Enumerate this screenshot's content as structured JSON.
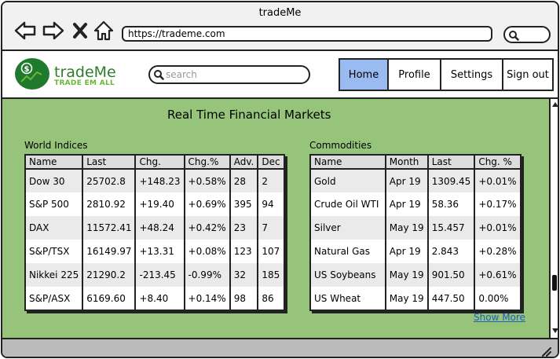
{
  "window": {
    "title": "tradeMe"
  },
  "browser": {
    "url": "https://trademe.com"
  },
  "brand": {
    "name": "tradeMe",
    "tagline": "TRADE EM ALL",
    "color": "#1f7a2e"
  },
  "search": {
    "placeholder": "search"
  },
  "nav": {
    "home": "Home",
    "profile": "Profile",
    "settings": "Settings",
    "signout": "Sign out",
    "active": "Home",
    "active_color": "#99bbf2"
  },
  "page": {
    "title": "Real Time Financial Markets",
    "background": "#95c47a",
    "show_more": "Show More"
  },
  "world_indices": {
    "label": "World Indices",
    "columns": [
      "Name",
      "Last",
      "Chg.",
      "Chg.%",
      "Adv.",
      "Dec"
    ],
    "rows": [
      [
        "Dow 30",
        "25702.8",
        "+148.23",
        "+0.58%",
        "28",
        "2"
      ],
      [
        "S&P 500",
        "2810.92",
        "+19.40",
        "+0.69%",
        "395",
        "94"
      ],
      [
        "DAX",
        "11572.41",
        "+48.24",
        "+0.42%",
        "23",
        "7"
      ],
      [
        "S&P/TSX",
        "16149.97",
        "+13.31",
        "+0.08%",
        "123",
        "107"
      ],
      [
        "Nikkei 225",
        "21290.2",
        "-213.45",
        "-0.99%",
        "32",
        "185"
      ],
      [
        "S&P/ASX",
        "6169.60",
        "+8.40",
        "+0.14%",
        "98",
        "86"
      ]
    ]
  },
  "commodities": {
    "label": "Commodities",
    "columns": [
      "Name",
      "Month",
      "Last",
      "Chg. %"
    ],
    "rows": [
      [
        "Gold",
        "Apr 19",
        "1309.45",
        "+0.01%"
      ],
      [
        "Crude Oil WTI",
        "Apr 19",
        "58.36",
        "+0.17%"
      ],
      [
        "Silver",
        "May 19",
        "15.457",
        "+0.01%"
      ],
      [
        "Natural Gas",
        "Apr 19",
        "2.843",
        "+0.28%"
      ],
      [
        "US Soybeans",
        "May 19",
        "901.50",
        "+0.61%"
      ],
      [
        "US Wheat",
        "May 19",
        "447.50",
        "0.00%"
      ]
    ]
  }
}
